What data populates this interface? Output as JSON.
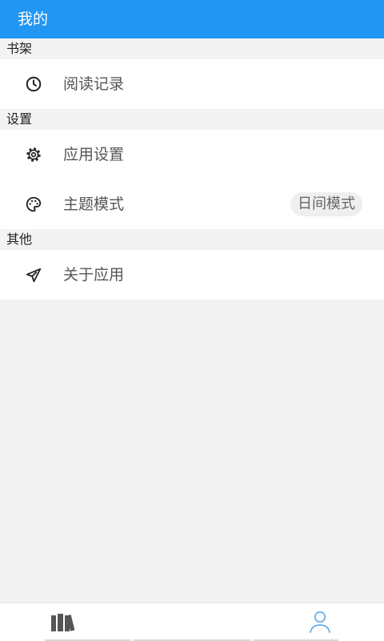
{
  "header": {
    "title": "我的"
  },
  "sections": [
    {
      "title": "书架",
      "items": [
        {
          "label": "阅读记录",
          "icon": "clock-icon"
        }
      ]
    },
    {
      "title": "设置",
      "items": [
        {
          "label": "应用设置",
          "icon": "gear-icon"
        },
        {
          "label": "主题模式",
          "icon": "palette-icon",
          "badge": "日间模式"
        }
      ]
    },
    {
      "title": "其他",
      "items": [
        {
          "label": "关于应用",
          "icon": "paper-plane-icon"
        }
      ]
    }
  ],
  "bottom_nav": {
    "tabs": [
      {
        "icon": "bookshelf-icon",
        "active": false
      },
      {
        "icon": "person-icon",
        "active": true
      }
    ]
  },
  "colors": {
    "primary": "#2196F3",
    "background": "#F3F3F3",
    "active_tab": "#6AAEE8",
    "inactive_tab": "#555555"
  }
}
